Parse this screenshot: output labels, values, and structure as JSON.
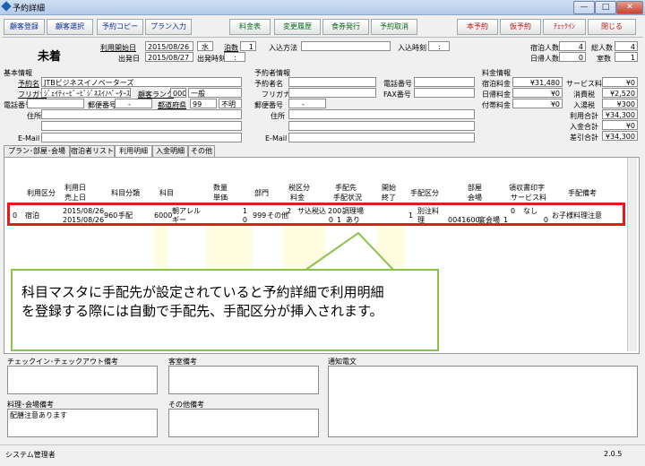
{
  "window": {
    "title": "予約詳細",
    "min": "—",
    "max": "□",
    "close": "✕"
  },
  "toolbar": {
    "left": [
      "顧客登録",
      "顧客選択",
      "予約コピー",
      "プラン入力"
    ],
    "middle": [
      "料金表",
      "変更履歴",
      "食券発行",
      "予約取消"
    ],
    "right": [
      "本予約",
      "仮予約",
      "ﾁｪｯｸｲﾝ",
      "閉じる"
    ]
  },
  "header": {
    "status": "未着",
    "start_label": "利用開始日",
    "start_date": "2015/08/26",
    "weekday": "水",
    "nights_label": "泊数",
    "nights": "1",
    "depart_label": "出発日",
    "depart_date": "2015/08/27",
    "depart_time_label": "出発時刻",
    "depart_time": "__:__",
    "entry_method_label": "入込方法",
    "entry_time_label": "入込時刻",
    "entry_time": "__:__",
    "guests_label": "宿泊人数",
    "guests": "4",
    "total_label": "総人数",
    "total": "4",
    "day_label": "日帰人数",
    "day": "0",
    "rooms_label": "室数",
    "rooms": "1"
  },
  "basic": {
    "section": "基本情報",
    "name_label": "予約名",
    "name": "JTBビジネスイノベーターズ",
    "kana_label": "フリガナ",
    "kana": "ｼﾞｪｲﾃｨｰﾋﾞｰﾋﾞｼﾞﾈｽｲﾉﾍﾞｰﾀｰｽﾞ",
    "rank_label": "顧客ランク",
    "rank_code": "000",
    "rank": "一般",
    "tel_label": "電話番号",
    "zip_label": "郵便番号",
    "zip": "___-____",
    "pref_label": "都道府県",
    "pref_code": "99",
    "pref": "不明",
    "addr_label": "住所",
    "email_label": "E-Mail"
  },
  "booker": {
    "section": "予約者情報",
    "name_label": "予約者名",
    "kana_label": "フリガナ",
    "tel_label": "電話番号",
    "fax_label": "FAX番号",
    "zip_label": "郵便番号",
    "zip": "___-____",
    "addr_label": "住所",
    "email_label": "E-Mail"
  },
  "fees": {
    "section": "料金情報",
    "rows": [
      {
        "l": "宿泊料金",
        "v": "¥31,480",
        "l2": "サービス料",
        "v2": "¥0"
      },
      {
        "l": "日帰料金",
        "v": "¥0",
        "l2": "消費税",
        "v2": "¥2,520"
      },
      {
        "l": "付帯料金",
        "v": "¥0",
        "l2": "入湯税",
        "v2": "¥300"
      }
    ],
    "use_total_label": "利用合計",
    "use_total": "¥34,300",
    "paid_label": "入金合計",
    "paid": "¥0",
    "diff_label": "差引合計",
    "diff": "¥34,300"
  },
  "tabs": [
    "プラン･部屋･会場",
    "宿泊者リスト",
    "利用明細",
    "入金明細",
    "その他"
  ],
  "grid": {
    "headers": [
      "利用区分",
      "利用日",
      "売上日",
      "科目分類",
      "科目",
      "数量",
      "単価",
      "部門",
      "税区分",
      "料金",
      "手配先",
      "手配状況",
      "開始",
      "終了",
      "手配区分",
      "部屋",
      "会場",
      "領収書印字",
      "サービス料",
      "手配備考"
    ],
    "row": {
      "idx": "0",
      "kubun": "宿泊",
      "date1": "2015/08/26",
      "date2": "2015/08/26",
      "cat_code": "960",
      "cat": "手配",
      "item_code": "6000",
      "item": "朝アレルギー",
      "qty": "1",
      "price": "0",
      "dept_code": "999",
      "dept": "その他",
      "tax_code": "2",
      "tax": "サ込税込",
      "tehai_code": "200",
      "tehai": "調理場",
      "fee": "0",
      "status_code": "1",
      "status": "あり",
      "kubun2_code": "1",
      "kubun2": "別注料理",
      "room": "0041600",
      "venue": "宴会場",
      "venue_code": "1",
      "receipt_code": "0",
      "receipt": "なし",
      "svc": "0",
      "note": "お子様料理注意"
    }
  },
  "callout": {
    "line1": "科目マスタに手配先が設定されていると予約詳細で利用明細",
    "line2": "を登録する際には自動で手配先、手配区分が挿入されます。"
  },
  "memos": {
    "checkin_label": "チェックイン･チェックアウト備考",
    "room_label": "客室備考",
    "notice_label": "通知電文",
    "food_label": "料理･会場備考",
    "food_text": "配膳注意あります",
    "other_label": "その他備考"
  },
  "status": {
    "user": "システム管理者",
    "version": "2.0.5"
  }
}
